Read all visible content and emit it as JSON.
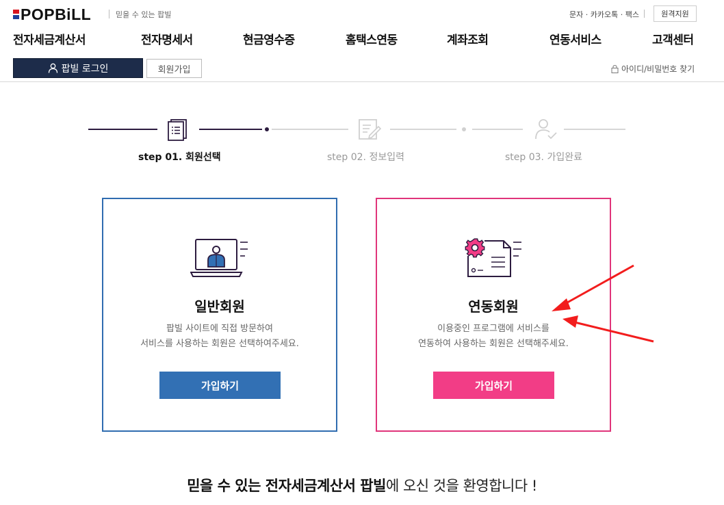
{
  "header": {
    "logo_text": "POPBiLL",
    "slogan": "믿을 수 있는 팝빌",
    "util_links": "문자 · 카카오톡 · 팩스",
    "remote_support": "원격지원",
    "brand_colors": {
      "red": "#d8141e",
      "blue": "#1f3f99"
    }
  },
  "gnb": [
    "전자세금계산서",
    "전자명세서",
    "현금영수증",
    "홈택스연동",
    "계좌조회",
    "연동서비스",
    "고객센터"
  ],
  "auth": {
    "login_label": "팝빌 로그인",
    "join_label": "회원가입",
    "find_label": "아이디/비밀번호 찾기"
  },
  "steps": [
    {
      "label": "step 01. 회원선택",
      "icon": "checklist-icon",
      "active": true
    },
    {
      "label": "step 02. 정보입력",
      "icon": "edit-document-icon",
      "active": false
    },
    {
      "label": "step 03. 가입완료",
      "icon": "user-check-icon",
      "active": false
    }
  ],
  "cards": {
    "general": {
      "title": "일반회원",
      "desc_line1": "팝빌 사이트에 직접 방문하여",
      "desc_line2": "서비스를 사용하는 회원은 선택하여주세요.",
      "button": "가입하기",
      "accent": "#2f6cb0",
      "icon": "laptop-user-icon"
    },
    "linked": {
      "title": "연동회원",
      "desc_line1": "이용중인 프로그램에 서비스를",
      "desc_line2": "연동하여 사용하는 회원은 선택해주세요.",
      "button": "가입하기",
      "accent": "#e0347a",
      "icon": "gear-document-icon"
    }
  },
  "welcome": {
    "bold_part": "믿을 수 있는 전자세금계산서 팝빌",
    "rest": "에 오신 것을 환영합니다 !"
  }
}
